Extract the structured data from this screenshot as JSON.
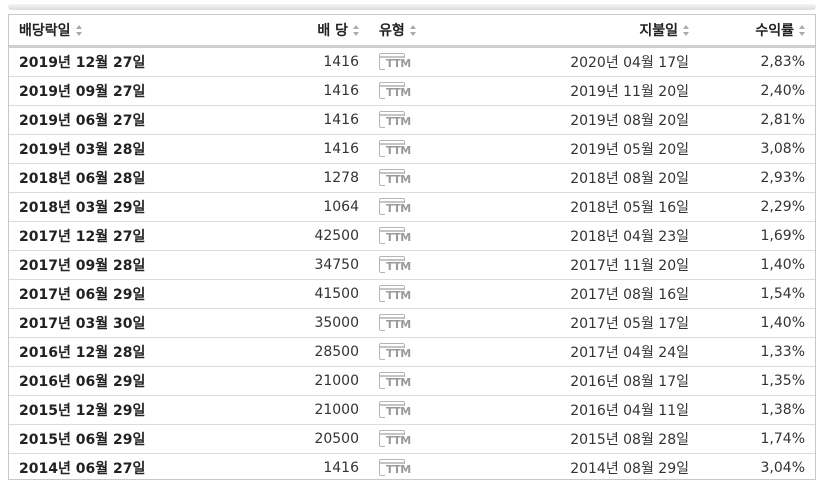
{
  "table": {
    "headers": {
      "ex_date": "배당락일",
      "dividend": "배 당",
      "type": "유형",
      "pay_date": "지불일",
      "yield": "수익률"
    },
    "rows": [
      {
        "ex_date": "2019년 12월 27일",
        "dividend": "1416",
        "type": "TTM",
        "pay_date": "2020년 04월 17일",
        "yield": "2,83%"
      },
      {
        "ex_date": "2019년 09월 27일",
        "dividend": "1416",
        "type": "TTM",
        "pay_date": "2019년 11월 20일",
        "yield": "2,40%"
      },
      {
        "ex_date": "2019년 06월 27일",
        "dividend": "1416",
        "type": "TTM",
        "pay_date": "2019년 08월 20일",
        "yield": "2,81%"
      },
      {
        "ex_date": "2019년 03월 28일",
        "dividend": "1416",
        "type": "TTM",
        "pay_date": "2019년 05월 20일",
        "yield": "3,08%"
      },
      {
        "ex_date": "2018년 06월 28일",
        "dividend": "1278",
        "type": "TTM",
        "pay_date": "2018년 08월 20일",
        "yield": "2,93%"
      },
      {
        "ex_date": "2018년 03월 29일",
        "dividend": "1064",
        "type": "TTM",
        "pay_date": "2018년 05월 16일",
        "yield": "2,29%"
      },
      {
        "ex_date": "2017년 12월 27일",
        "dividend": "42500",
        "type": "TTM",
        "pay_date": "2018년 04월 23일",
        "yield": "1,69%"
      },
      {
        "ex_date": "2017년 09월 28일",
        "dividend": "34750",
        "type": "TTM",
        "pay_date": "2017년 11월 20일",
        "yield": "1,40%"
      },
      {
        "ex_date": "2017년 06월 29일",
        "dividend": "41500",
        "type": "TTM",
        "pay_date": "2017년 08월 16일",
        "yield": "1,54%"
      },
      {
        "ex_date": "2017년 03월 30일",
        "dividend": "35000",
        "type": "TTM",
        "pay_date": "2017년 05월 17일",
        "yield": "1,40%"
      },
      {
        "ex_date": "2016년 12월 28일",
        "dividend": "28500",
        "type": "TTM",
        "pay_date": "2017년 04월 24일",
        "yield": "1,33%"
      },
      {
        "ex_date": "2016년 06월 29일",
        "dividend": "21000",
        "type": "TTM",
        "pay_date": "2016년 08월 17일",
        "yield": "1,35%"
      },
      {
        "ex_date": "2015년 12월 29일",
        "dividend": "21000",
        "type": "TTM",
        "pay_date": "2016년 04월 11일",
        "yield": "1,38%"
      },
      {
        "ex_date": "2015년 06월 29일",
        "dividend": "20500",
        "type": "TTM",
        "pay_date": "2015년 08월 28일",
        "yield": "1,74%"
      },
      {
        "ex_date": "2014년 06월 27일",
        "dividend": "1416",
        "type": "TTM",
        "pay_date": "2014년 08월 29일",
        "yield": "3,04%"
      }
    ]
  },
  "icons": {
    "sort": "sort-arrows-icon",
    "type": "calendar-ttm-icon"
  },
  "colors": {
    "border": "#c8c8c8",
    "row_divider": "#dcdcdc",
    "icon_gray": "#9a9a9a"
  }
}
